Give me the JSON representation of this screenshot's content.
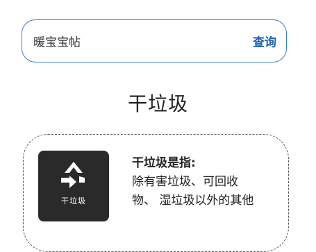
{
  "search": {
    "value": "暖宝宝帖",
    "button_label": "查询"
  },
  "result": {
    "category_title": "干垃圾",
    "icon": {
      "name": "recycle-arrows-icon",
      "caption": "干垃圾"
    },
    "definition": {
      "heading": "干垃圾是指:",
      "lines": [
        "除有害垃圾、可回收",
        "物、 湿垃圾以外的其他"
      ]
    }
  },
  "colors": {
    "accent": "#1d63b0",
    "border": "#3a7dc8",
    "icon_bg": "#2a2a2a"
  }
}
